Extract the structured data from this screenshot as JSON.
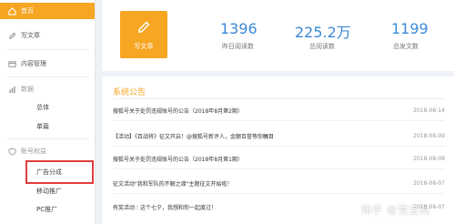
{
  "sidebar": {
    "home": "首页",
    "write": "写文章",
    "content_manage": "内容管理",
    "data_group": "数据",
    "data_items": [
      "总体",
      "单篇"
    ],
    "account_group": "账号权益",
    "account_items": [
      "广告分成",
      "移动推广",
      "PC推广"
    ]
  },
  "stats": {
    "write_label": "写文章",
    "items": [
      {
        "value": "1396",
        "label": "昨日阅读数"
      },
      {
        "value": "225.2万",
        "label": "总阅读数"
      },
      {
        "value": "1199",
        "label": "总发文数"
      }
    ]
  },
  "notice": {
    "title": "系统公告",
    "rows": [
      {
        "text": "搜狐号关于处罚违规账号的公告（2018年8月第2期）",
        "date": "2018-08-14"
      },
      {
        "text": "【活动】《百战将》征文开启！@搜狐号新评人，金额百誉等你瞩目",
        "date": "2018-08-09"
      },
      {
        "text": "搜狐号关于处罚违规账号的公告（2018年8月第1期）",
        "date": "2018-08-08"
      },
      {
        "text": "征文活动\"我和军队的不解之缘\"主题征文开始啦！",
        "date": "2018-08-07"
      },
      {
        "text": "有奖活动｜这个七夕，我想和你一起度过！",
        "date": "2018-08-07"
      }
    ]
  },
  "watermark": "知乎 @党宝财",
  "colors": {
    "accent": "#f6a623",
    "stat_blue": "#3b8ad9",
    "highlight_red": "#e23d3d"
  }
}
